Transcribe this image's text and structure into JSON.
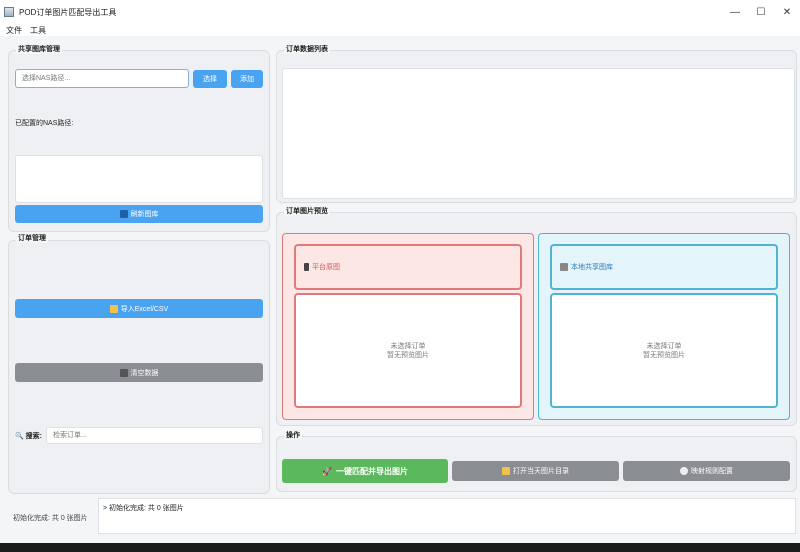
{
  "window": {
    "title": "POD订单图片匹配导出工具",
    "minimize": "—",
    "maximize": "☐",
    "close": "✕"
  },
  "menu": [
    "文件",
    "工具"
  ],
  "library": {
    "title": "共享图库管理",
    "nas_placeholder": "选择NAS路径...",
    "select_label": "选择",
    "add_label": "添加",
    "configured_label": "已配置的NAS路径:",
    "refresh_label": "刷新图库"
  },
  "orders": {
    "title": "订单管理",
    "import_label": "导入Excel/CSV",
    "clear_label": "清空数据",
    "search_label": "搜索:",
    "search_placeholder": "检索订单..."
  },
  "order_list": {
    "title": "订单数据列表"
  },
  "preview": {
    "title": "订单图片预览",
    "platform_label": "平台原图",
    "local_label": "本地共享图库",
    "empty_line1": "未选择订单",
    "empty_line2": "暂无预览图片"
  },
  "actions": {
    "title": "操作",
    "match_export_label": "一键匹配并导出图片",
    "open_dir_label": "打开当天图片目录",
    "mapping_label": "映射规则配置"
  },
  "status": {
    "left_text": "初始化完成: 共 0 张图片",
    "log_text": "> 初始化完成: 共 0 张图片"
  },
  "colors": {
    "blue": "#4aa3f0",
    "gray": "#8a8d91",
    "green": "#5cb85c",
    "red_border": "#e07a7a",
    "cyan_border": "#4fb3d1"
  }
}
